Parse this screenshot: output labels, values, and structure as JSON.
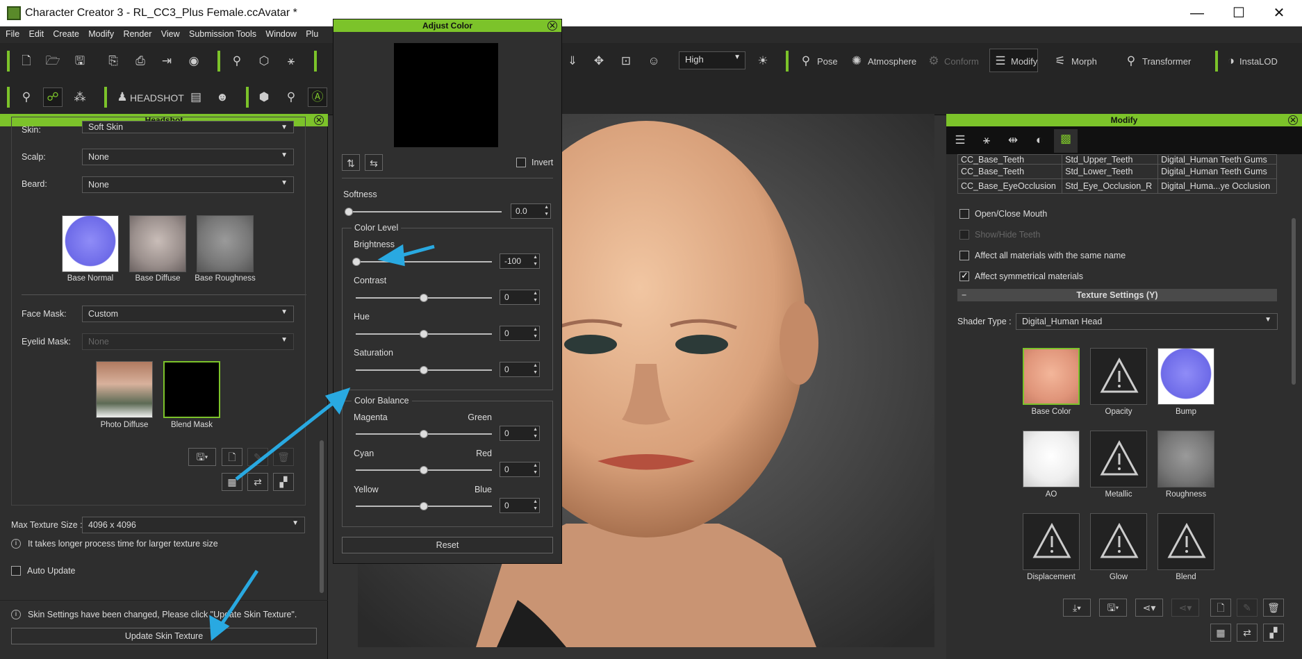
{
  "window": {
    "title": "Character Creator 3 - RL_CC3_Plus Female.ccAvatar *",
    "minimize": "—",
    "maximize": "☐",
    "close": "✕"
  },
  "menu": [
    "File",
    "Edit",
    "Create",
    "Modify",
    "Render",
    "View",
    "Submission Tools",
    "Window",
    "Plu"
  ],
  "toolbar": {
    "quality": "High",
    "pose": "Pose",
    "atmosphere": "Atmosphere",
    "conform": "Conform",
    "modify": "Modify",
    "morph": "Morph",
    "transformer": "Transformer",
    "instalod": "InstaLOD",
    "headshot": "HEADSHOT"
  },
  "headshot_panel": {
    "title": "Headshot",
    "skin_label": "Skin:",
    "skin_value": "Soft Skin",
    "scalp_label": "Scalp:",
    "scalp_value": "None",
    "beard_label": "Beard:",
    "beard_value": "None",
    "textures": [
      "Base Normal",
      "Base Diffuse",
      "Base Roughness"
    ],
    "face_mask_label": "Face Mask:",
    "face_mask_value": "Custom",
    "eyelid_mask_label": "Eyelid Mask:",
    "eyelid_mask_value": "None",
    "mask_textures": [
      "Photo Diffuse",
      "Blend Mask"
    ],
    "max_texture_label": "Max Texture Size :",
    "max_texture_value": "4096 x 4096",
    "info_text": "It takes longer process time for larger texture size",
    "auto_update": "Auto Update",
    "status_text": "Skin Settings have been changed, Please click \"Update Skin Texture\".",
    "update_button": "Update Skin Texture"
  },
  "adjust_color": {
    "title": "Adjust Color",
    "invert": "Invert",
    "softness_label": "Softness",
    "softness_value": "0.0",
    "color_level": "Color Level",
    "brightness": "Brightness",
    "brightness_value": "-100",
    "contrast": "Contrast",
    "contrast_value": "0",
    "hue": "Hue",
    "hue_value": "0",
    "saturation": "Saturation",
    "saturation_value": "0",
    "color_balance": "Color Balance",
    "magenta": "Magenta",
    "green": "Green",
    "mg_value": "0",
    "cyan": "Cyan",
    "red": "Red",
    "cr_value": "0",
    "yellow": "Yellow",
    "blue": "Blue",
    "yb_value": "0",
    "reset": "Reset"
  },
  "modify_panel": {
    "title": "Modify",
    "table": [
      [
        "CC_Base_Teeth",
        "Std_Upper_Teeth",
        "Digital_Human Teeth Gums"
      ],
      [
        "CC_Base_Teeth",
        "Std_Lower_Teeth",
        "Digital_Human Teeth Gums"
      ],
      [
        "CC_Base_EyeOcclusion",
        "Std_Eye_Occlusion_R",
        "Digital_Huma...ye Occlusion"
      ]
    ],
    "open_close_mouth": "Open/Close Mouth",
    "show_hide_teeth": "Show/Hide Teeth",
    "affect_same_name": "Affect all materials with the same name",
    "affect_symmetrical": "Affect symmetrical materials",
    "texture_settings": "Texture Settings  (Y)",
    "shader_type_label": "Shader Type :",
    "shader_type_value": "Digital_Human Head",
    "channels": [
      "Base Color",
      "Opacity",
      "Bump",
      "AO",
      "Metallic",
      "Roughness",
      "Displacement",
      "Glow",
      "Blend"
    ]
  },
  "colors": {
    "accent": "#7cc32a",
    "annotation_arrow": "#29a9e1"
  }
}
